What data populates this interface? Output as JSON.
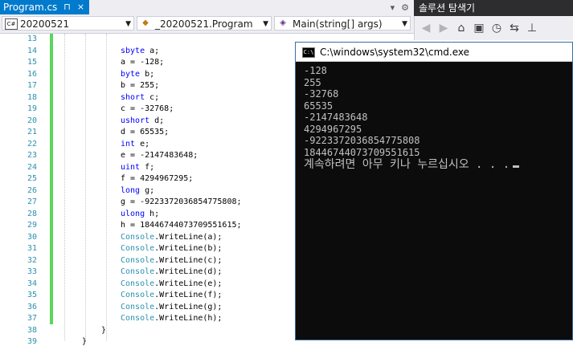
{
  "tab": {
    "title": "Program.cs",
    "pin": "⊓",
    "close": "×"
  },
  "tabbar_right": {
    "dropdown": "▾",
    "gear": "⚙"
  },
  "nav": {
    "project": "20200521",
    "project_icon": "C#",
    "class": "_20200521.Program",
    "member": "Main(string[] args)"
  },
  "solution_explorer": {
    "title": "솔루션 탐색기",
    "toolbar_icons": [
      "back-icon",
      "forward-icon",
      "home-icon",
      "switch-views-icon",
      "history-icon",
      "sync-icon",
      "pin-icon"
    ]
  },
  "editor": {
    "line_numbers": [
      "13",
      "14",
      "15",
      "16",
      "17",
      "18",
      "19",
      "20",
      "21",
      "22",
      "23",
      "24",
      "25",
      "26",
      "27",
      "28",
      "29",
      "30",
      "31",
      "32",
      "33",
      "34",
      "35",
      "36",
      "37",
      "38",
      "39"
    ],
    "lines": [
      [],
      [
        {
          "t": "sbyte",
          "c": "kw"
        },
        {
          "t": " a;"
        }
      ],
      [
        {
          "t": "a = -128;"
        }
      ],
      [
        {
          "t": "byte",
          "c": "kw"
        },
        {
          "t": " b;"
        }
      ],
      [
        {
          "t": "b = 255;"
        }
      ],
      [
        {
          "t": "short",
          "c": "kw"
        },
        {
          "t": " c;"
        }
      ],
      [
        {
          "t": "c = -32768;"
        }
      ],
      [
        {
          "t": "ushort",
          "c": "kw"
        },
        {
          "t": " d;"
        }
      ],
      [
        {
          "t": "d = 65535;"
        }
      ],
      [
        {
          "t": "int",
          "c": "kw"
        },
        {
          "t": " e;"
        }
      ],
      [
        {
          "t": "e = -2147483648;"
        }
      ],
      [
        {
          "t": "uint",
          "c": "kw"
        },
        {
          "t": " f;"
        }
      ],
      [
        {
          "t": "f = 4294967295;"
        }
      ],
      [
        {
          "t": "long",
          "c": "kw"
        },
        {
          "t": " g;"
        }
      ],
      [
        {
          "t": "g = -9223372036854775808;"
        }
      ],
      [
        {
          "t": "ulong",
          "c": "kw"
        },
        {
          "t": " h;"
        }
      ],
      [
        {
          "t": "h = 18446744073709551615;"
        }
      ],
      [
        {
          "t": "Console",
          "c": "cls"
        },
        {
          "t": ".WriteLine(a);"
        }
      ],
      [
        {
          "t": "Console",
          "c": "cls"
        },
        {
          "t": ".WriteLine(b);"
        }
      ],
      [
        {
          "t": "Console",
          "c": "cls"
        },
        {
          "t": ".WriteLine(c);"
        }
      ],
      [
        {
          "t": "Console",
          "c": "cls"
        },
        {
          "t": ".WriteLine(d);"
        }
      ],
      [
        {
          "t": "Console",
          "c": "cls"
        },
        {
          "t": ".WriteLine(e);"
        }
      ],
      [
        {
          "t": "Console",
          "c": "cls"
        },
        {
          "t": ".WriteLine(f);"
        }
      ],
      [
        {
          "t": "Console",
          "c": "cls"
        },
        {
          "t": ".WriteLine(g);"
        }
      ],
      [
        {
          "t": "Console",
          "c": "cls"
        },
        {
          "t": ".WriteLine(h);"
        }
      ],
      [
        {
          "t": "}"
        }
      ],
      [
        {
          "t": "}"
        }
      ]
    ]
  },
  "console": {
    "title": "C:\\windows\\system32\\cmd.exe",
    "output": [
      "-128",
      "255",
      "-32768",
      "65535",
      "-2147483648",
      "4294967295",
      "-9223372036854775808",
      "18446744073709551615",
      "계속하려면 아무 키나 누르십시오 . . ."
    ]
  },
  "colors": {
    "accent": "#007acc",
    "keyword": "#0000ff",
    "type": "#2b91af",
    "changed_margin": "#59d65d",
    "console_bg": "#0c0c0c"
  }
}
